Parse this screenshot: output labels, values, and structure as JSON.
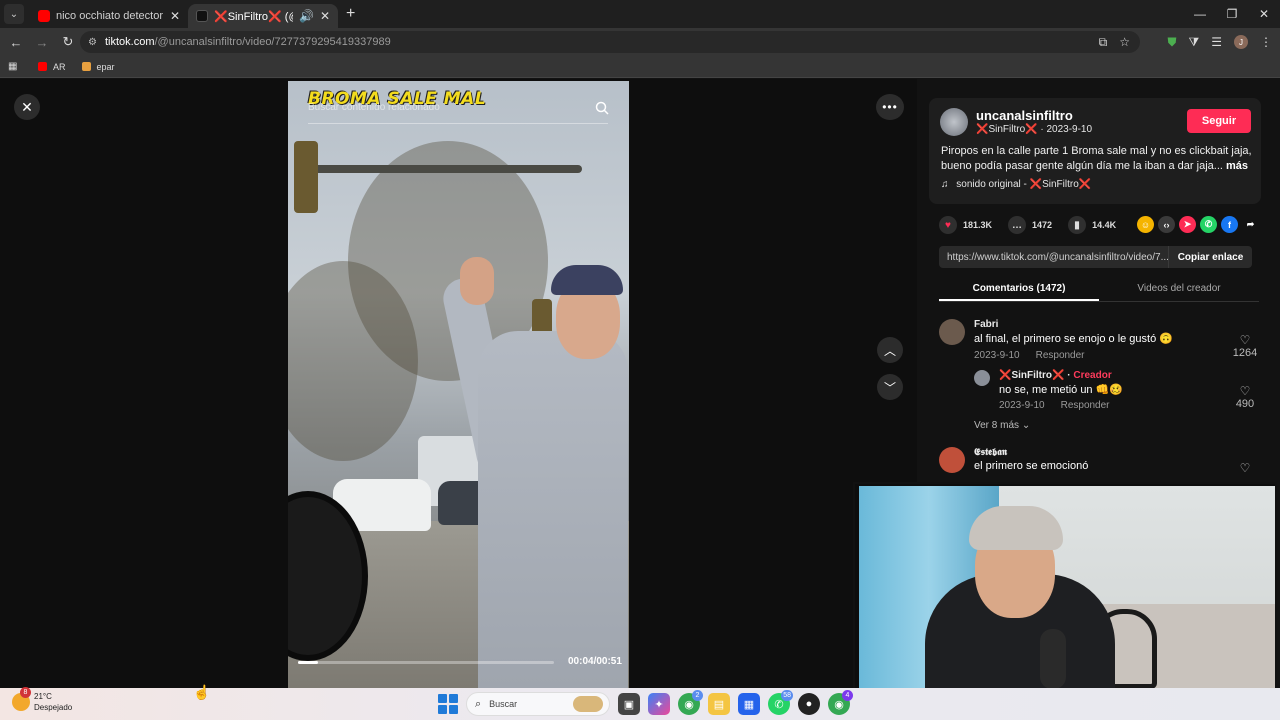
{
  "browser": {
    "tabs": [
      {
        "title": "nico occhiato detector de menti",
        "favicon_color": "#ff0000",
        "active": false
      },
      {
        "title": "❌SinFiltro❌ (@uncanalsinfiltro)",
        "favicon_color": "#111111",
        "active": true
      }
    ],
    "url_domain": "tiktok.com",
    "url_path": "/@uncanalsinfiltro/video/7277379295419337989",
    "profile_initial": "J",
    "bookmarks": [
      {
        "label": "AR",
        "color": "#ff0000"
      },
      {
        "label": "epar",
        "color": "#e8a040"
      }
    ]
  },
  "video": {
    "overlay_title": "BROMA SALE MAL",
    "overlay_search": "Buscar contenido relacionado",
    "time": "00:04/00:51",
    "progress": 0.08
  },
  "post": {
    "username": "uncanalsinfiltro",
    "display_name": "❌SinFiltro❌",
    "date": "2023-9-10",
    "follow_label": "Seguir",
    "description": "Piropos en la calle parte 1 Broma sale mal y no es clickbait jaja, bueno podía pasar gente algún día me la iban a dar jaja...",
    "more_label": "más",
    "sound": "sonido original - ❌SinFiltro❌",
    "likes": "181.3K",
    "comments_count": "1472",
    "saves": "14.4K",
    "link": "https://www.tiktok.com/@uncanalsinfiltro/video/7...",
    "copy_label": "Copiar enlace",
    "tab_comments": "Comentarios (1472)",
    "tab_videos": "Videos del creador"
  },
  "comments": [
    {
      "name": "Fabri",
      "text": "al final, el primero se enojo o le gustó 🙃",
      "date": "2023-9-10",
      "reply_label": "Responder",
      "likes": "1264"
    },
    {
      "name": "❌SinFiltro❌",
      "creator_tag": "Creador",
      "text": "no se, me metió un 👊🥴",
      "date": "2023-9-10",
      "reply_label": "Responder",
      "likes": "490"
    },
    {
      "name": "𝕰𝖘𝖙𝖊𝖇𝖆𝖓",
      "text": "el primero se emocionó",
      "likes": ""
    }
  ],
  "more_replies": "Ver 8 más",
  "taskbar": {
    "temp": "21°C",
    "weather": "Despejado",
    "weather_badge": "8",
    "search_label": "Buscar",
    "badges": [
      "2",
      "58",
      "4"
    ]
  }
}
